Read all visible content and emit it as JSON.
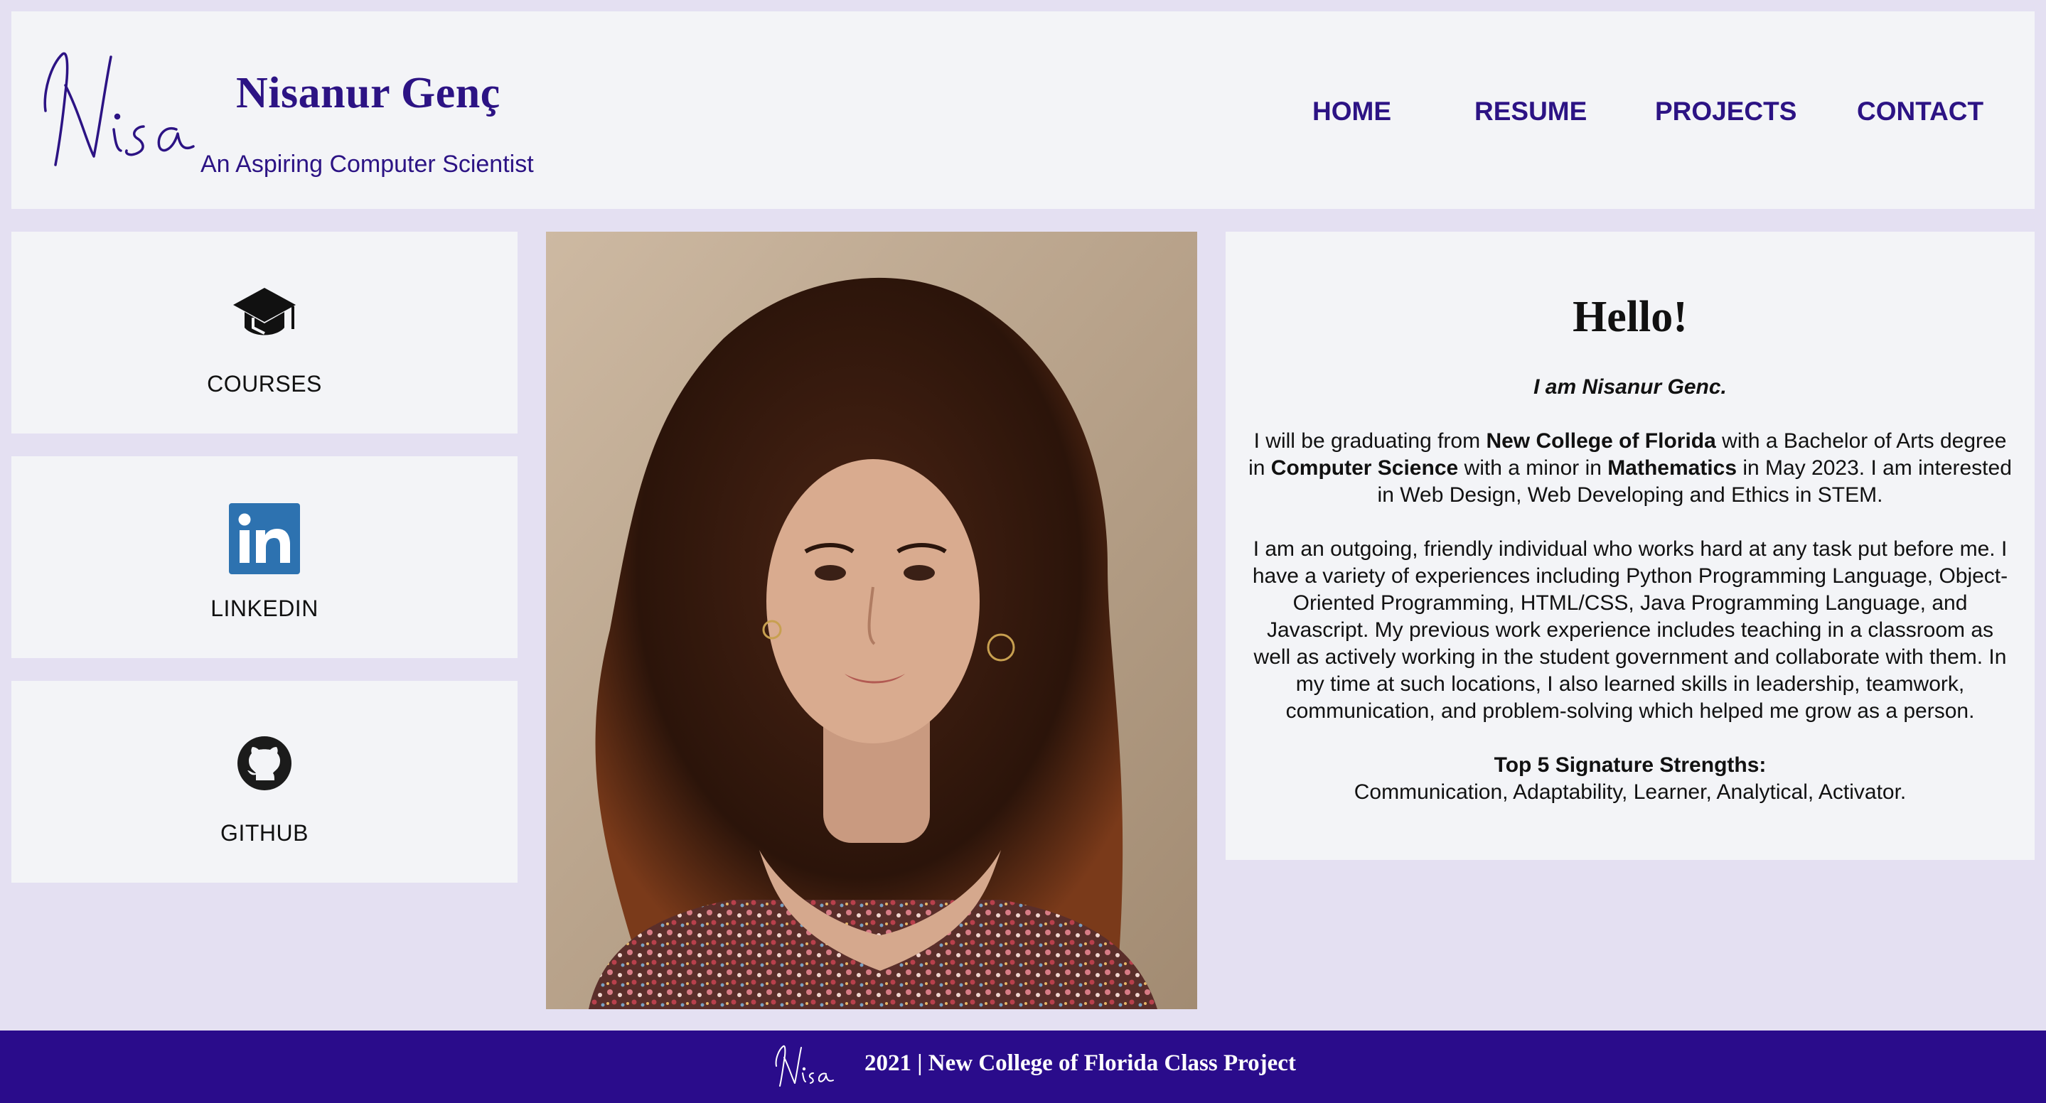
{
  "header": {
    "logo_text": "Nisa",
    "site_name": "Nisanur Genç",
    "tagline": "An Aspiring Computer Scientist",
    "nav": [
      {
        "label": "HOME"
      },
      {
        "label": "RESUME"
      },
      {
        "label": "PROJECTS"
      },
      {
        "label": "CONTACT"
      }
    ]
  },
  "sidebar": {
    "cards": [
      {
        "label": "COURSES",
        "icon": "graduation-cap-icon"
      },
      {
        "label": "LINKEDIN",
        "icon": "linkedin-icon"
      },
      {
        "label": "GITHUB",
        "icon": "github-icon"
      }
    ]
  },
  "intro": {
    "heading": "Hello!",
    "iam": "I am Nisanur Genc.",
    "p1": {
      "t1": "I will be graduating from ",
      "b1": "New College of Florida",
      "t2": " with a Bachelor of Arts degree in ",
      "b2": "Computer Science",
      "t3": " with a minor in ",
      "b3": "Mathematics",
      "t4": " in May 2023. I am interested in Web Design, Web Developing and Ethics in STEM."
    },
    "p2": "I am an outgoing, friendly individual who works hard at any task put before me. I have a variety of experiences including Python Programming Language, Object-Oriented Programming, HTML/CSS, Java Programming Language, and Javascript. My previous work experience includes teaching in a classroom as well as actively working in the student government and collaborate with them. In my time at such locations, I also learned skills in leadership, teamwork, communication, and problem-solving which helped me grow as a person.",
    "strengths_title": "Top 5 Signature Strengths:",
    "strengths": "Communication, Adaptability, Learner, Analytical, Activator."
  },
  "footer": {
    "logo_text": "Nisa",
    "text": "2021  |  New College of Florida Class Project"
  },
  "colors": {
    "background": "#e4e0f2",
    "panel": "#f3f4f7",
    "brand": "#2c1384",
    "footer": "#2a0c8b",
    "linkedin": "#2d72b0"
  }
}
